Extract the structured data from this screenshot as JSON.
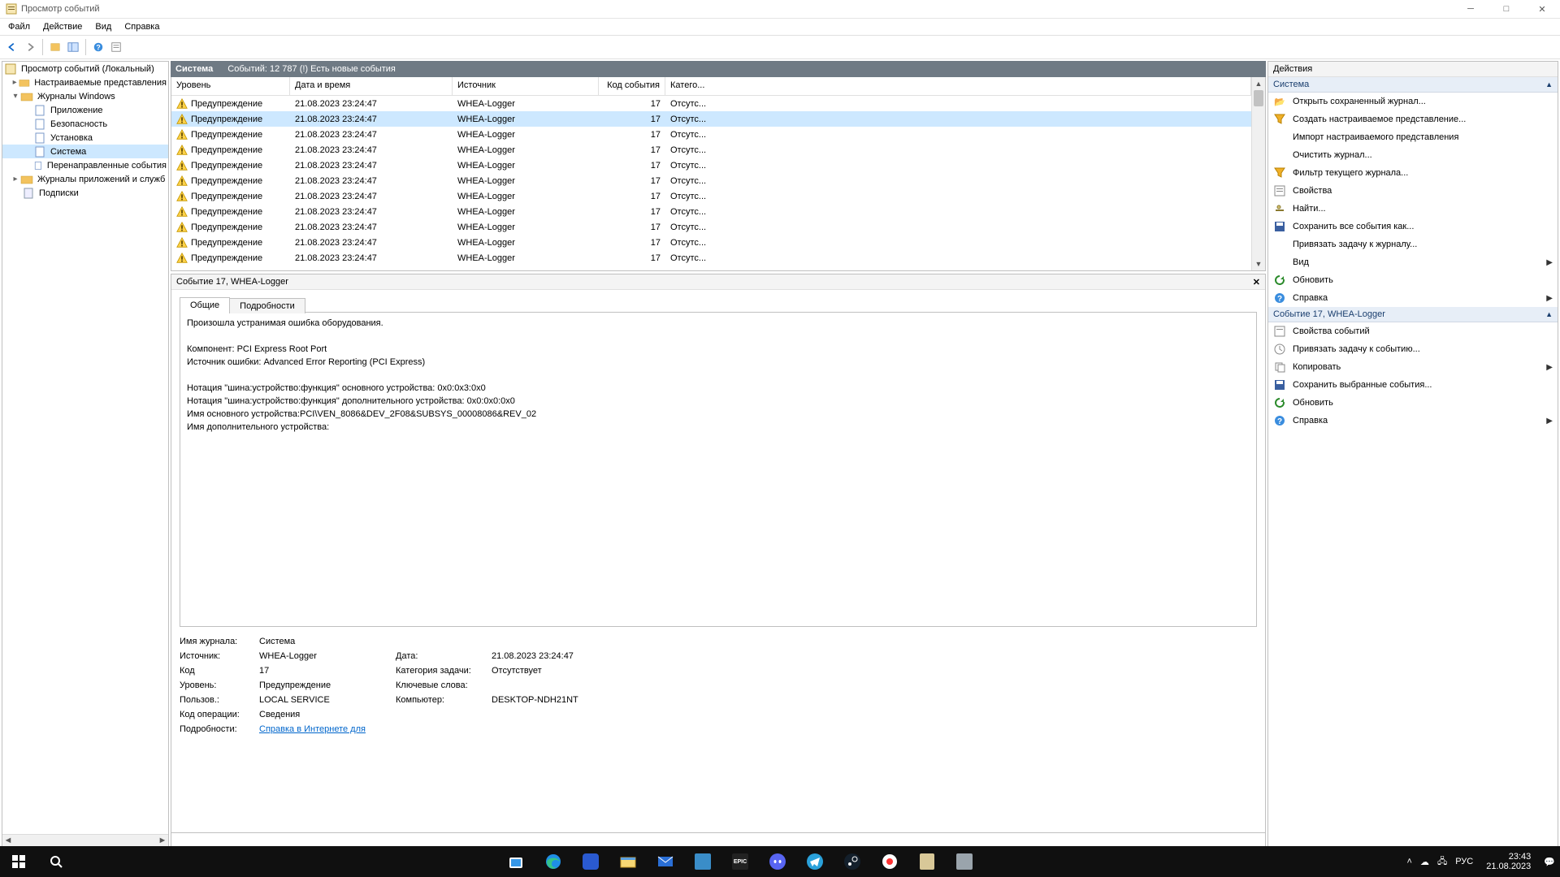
{
  "window": {
    "title": "Просмотр событий"
  },
  "menu": {
    "file": "Файл",
    "action": "Действие",
    "view": "Вид",
    "help": "Справка"
  },
  "tree": {
    "root": "Просмотр событий (Локальный)",
    "custom": "Настраиваемые представления",
    "winlogs": "Журналы Windows",
    "app": "Приложение",
    "sec": "Безопасность",
    "setup": "Установка",
    "system": "Система",
    "fwd": "Перенаправленные события",
    "appsvc": "Журналы приложений и служб",
    "subs": "Подписки"
  },
  "center": {
    "title": "Система",
    "count": "Событий: 12 787 (!) Есть новые события",
    "cols": {
      "level": "Уровень",
      "datetime": "Дата и время",
      "source": "Источник",
      "code": "Код события",
      "cat": "Катего..."
    },
    "rows": [
      {
        "level": "Предупреждение",
        "dt": "21.08.2023 23:24:47",
        "src": "WHEA-Logger",
        "code": "17",
        "cat": "Отсутс..."
      },
      {
        "level": "Предупреждение",
        "dt": "21.08.2023 23:24:47",
        "src": "WHEA-Logger",
        "code": "17",
        "cat": "Отсутс..."
      },
      {
        "level": "Предупреждение",
        "dt": "21.08.2023 23:24:47",
        "src": "WHEA-Logger",
        "code": "17",
        "cat": "Отсутс..."
      },
      {
        "level": "Предупреждение",
        "dt": "21.08.2023 23:24:47",
        "src": "WHEA-Logger",
        "code": "17",
        "cat": "Отсутс..."
      },
      {
        "level": "Предупреждение",
        "dt": "21.08.2023 23:24:47",
        "src": "WHEA-Logger",
        "code": "17",
        "cat": "Отсутс..."
      },
      {
        "level": "Предупреждение",
        "dt": "21.08.2023 23:24:47",
        "src": "WHEA-Logger",
        "code": "17",
        "cat": "Отсутс..."
      },
      {
        "level": "Предупреждение",
        "dt": "21.08.2023 23:24:47",
        "src": "WHEA-Logger",
        "code": "17",
        "cat": "Отсутс..."
      },
      {
        "level": "Предупреждение",
        "dt": "21.08.2023 23:24:47",
        "src": "WHEA-Logger",
        "code": "17",
        "cat": "Отсутс..."
      },
      {
        "level": "Предупреждение",
        "dt": "21.08.2023 23:24:47",
        "src": "WHEA-Logger",
        "code": "17",
        "cat": "Отсутс..."
      },
      {
        "level": "Предупреждение",
        "dt": "21.08.2023 23:24:47",
        "src": "WHEA-Logger",
        "code": "17",
        "cat": "Отсутс..."
      },
      {
        "level": "Предупреждение",
        "dt": "21.08.2023 23:24:47",
        "src": "WHEA-Logger",
        "code": "17",
        "cat": "Отсутс..."
      }
    ]
  },
  "detail": {
    "title": "Событие 17, WHEA-Logger",
    "tab_general": "Общие",
    "tab_details": "Подробности",
    "desc": "Произошла устранимая ошибка оборудования.\n\nКомпонент: PCI Express Root Port\nИсточник ошибки: Advanced Error Reporting (PCI Express)\n\nНотация \"шина:устройство:функция\" основного устройства: 0x0:0x3:0x0\nНотация \"шина:устройство:функция\" дополнительного устройства: 0x0:0x0:0x0\nИмя основного устройства:PCI\\VEN_8086&DEV_2F08&SUBSYS_00008086&REV_02\nИмя дополнительного устройства:",
    "p": {
      "log_l": "Имя журнала:",
      "log_v": "Система",
      "src_l": "Источник:",
      "src_v": "WHEA-Logger",
      "date_l": "Дата:",
      "date_v": "21.08.2023 23:24:47",
      "code_l": "Код",
      "code_v": "17",
      "cat_l": "Категория задачи:",
      "cat_v": "Отсутствует",
      "lvl_l": "Уровень:",
      "lvl_v": "Предупреждение",
      "kw_l": "Ключевые слова:",
      "kw_v": "",
      "user_l": "Пользов.:",
      "user_v": "LOCAL SERVICE",
      "comp_l": "Компьютер:",
      "comp_v": "DESKTOP-NDH21NT",
      "op_l": "Код операции:",
      "op_v": "Сведения",
      "more_l": "Подробности:",
      "more_v": "Справка в Интернете для "
    }
  },
  "actions": {
    "header": "Действия",
    "sec1": "Система",
    "open": "Открыть сохраненный журнал...",
    "custom": "Создать настраиваемое представление...",
    "import": "Импорт настраиваемого представления",
    "clear": "Очистить журнал...",
    "filter": "Фильтр текущего журнала...",
    "props": "Свойства",
    "find": "Найти...",
    "saveall": "Сохранить все события как...",
    "attach": "Привязать задачу к журналу...",
    "view": "Вид",
    "refresh": "Обновить",
    "help": "Справка",
    "sec2": "Событие 17, WHEA-Logger",
    "evprops": "Свойства событий",
    "evattach": "Привязать задачу к событию...",
    "copy": "Копировать",
    "savesel": "Сохранить выбранные события...",
    "refresh2": "Обновить",
    "help2": "Справка"
  },
  "taskbar": {
    "lang": "РУС",
    "time": "23:43",
    "date": "21.08.2023"
  }
}
